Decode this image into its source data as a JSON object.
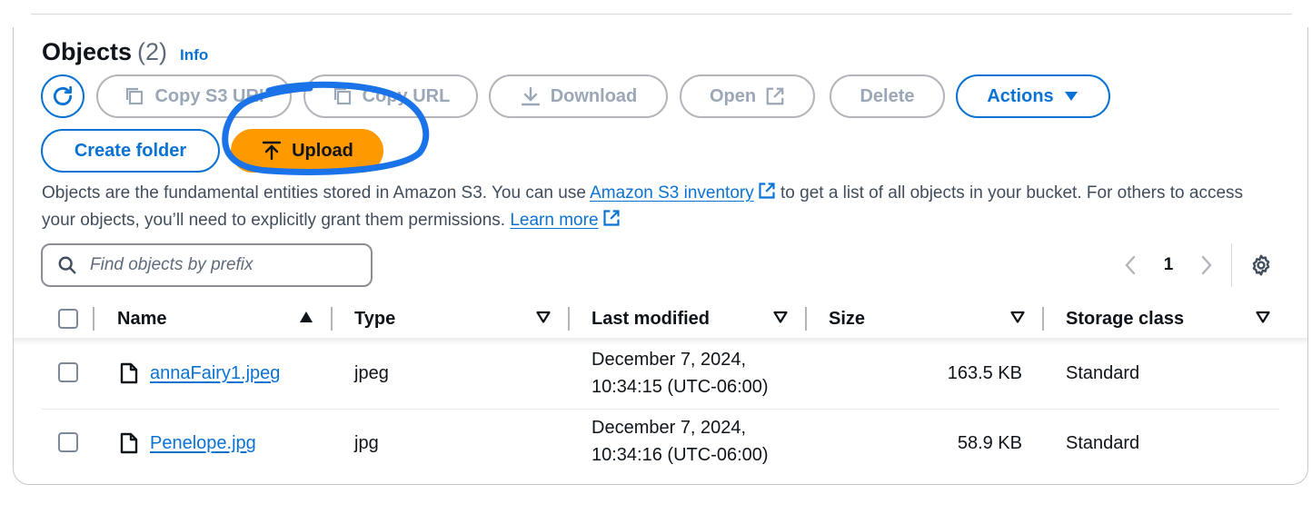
{
  "section": {
    "title": "Objects",
    "count": "(2)",
    "info_link": "Info"
  },
  "toolbar": {
    "refresh_icon": "refresh-icon",
    "copy_s3_uri": "Copy S3 URI",
    "copy_url": "Copy URL",
    "download": "Download",
    "open": "Open",
    "delete": "Delete",
    "actions": "Actions",
    "create_folder": "Create folder",
    "upload": "Upload"
  },
  "description": {
    "part1": "Objects are the fundamental entities stored in Amazon S3. You can use ",
    "link1": "Amazon S3 inventory",
    "part2": " to get a list of all objects in your bucket. For others to access your objects, you’ll need to explicitly grant them permissions. ",
    "link2": "Learn more"
  },
  "search": {
    "placeholder": "Find objects by prefix"
  },
  "pagination": {
    "current_page": "1"
  },
  "table": {
    "columns": [
      "Name",
      "Type",
      "Last modified",
      "Size",
      "Storage class"
    ],
    "rows": [
      {
        "name": "annaFairy1.jpeg",
        "type": "jpeg",
        "modified_line1": "December 7, 2024,",
        "modified_line2": "10:34:15 (UTC-06:00)",
        "size": "163.5 KB",
        "storage_class": "Standard"
      },
      {
        "name": "Penelope.jpg",
        "type": "jpg",
        "modified_line1": "December 7, 2024,",
        "modified_line2": "10:34:16 (UTC-06:00)",
        "size": "58.9 KB",
        "storage_class": "Standard"
      }
    ]
  },
  "colors": {
    "link_blue": "#0972d3",
    "upload_orange": "#ff9900",
    "annotation_blue": "#1a73e8",
    "disabled_gray": "#9ba7b6"
  }
}
